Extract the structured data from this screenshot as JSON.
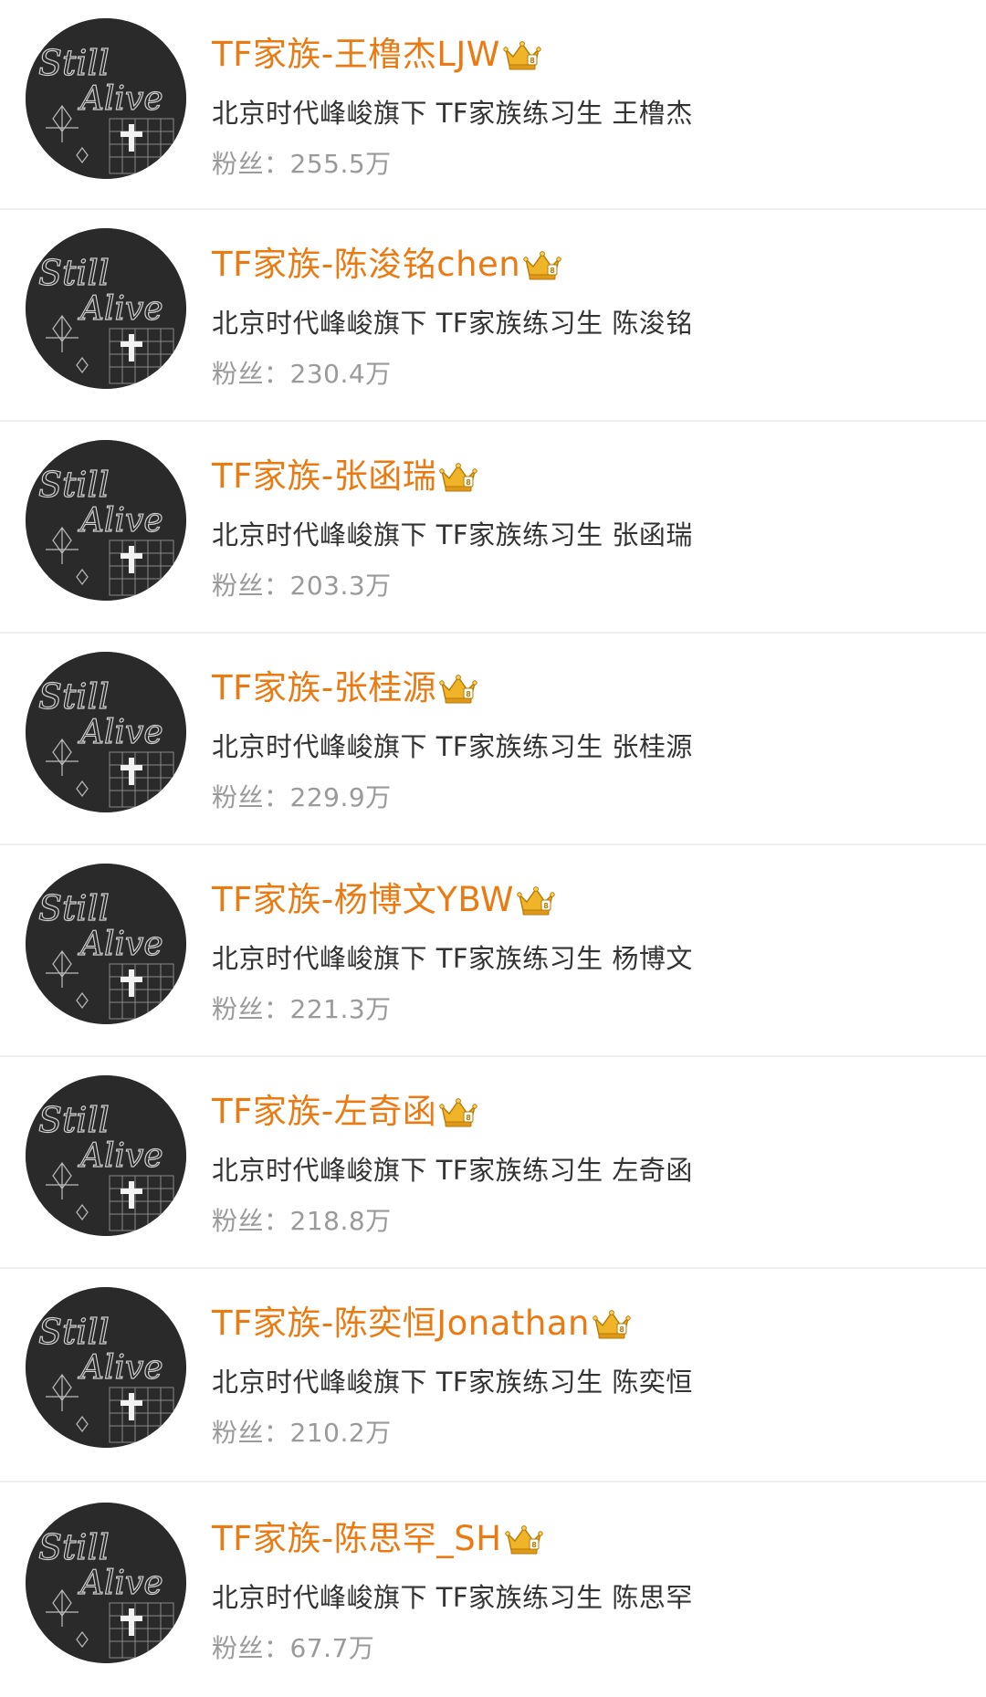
{
  "accounts": [
    {
      "name": "TF家族-王橹杰LJW",
      "desc": "北京时代峰峻旗下 TF家族练习生 王橹杰",
      "fans_label": "粉丝：",
      "fans_value": "255.5万",
      "badge_icon": "crown-icon"
    },
    {
      "name": "TF家族-陈浚铭chen",
      "desc": "北京时代峰峻旗下 TF家族练习生  陈浚铭",
      "fans_label": "粉丝：",
      "fans_value": "230.4万",
      "badge_icon": "crown-icon"
    },
    {
      "name": "TF家族-张函瑞",
      "desc": "北京时代峰峻旗下 TF家族练习生  张函瑞",
      "fans_label": "粉丝：",
      "fans_value": "203.3万",
      "badge_icon": "crown-icon"
    },
    {
      "name": "TF家族-张桂源",
      "desc": "北京时代峰峻旗下 TF家族练习生  张桂源",
      "fans_label": "粉丝：",
      "fans_value": "229.9万",
      "badge_icon": "crown-icon"
    },
    {
      "name": "TF家族-杨博文YBW",
      "desc": "北京时代峰峻旗下 TF家族练习生  杨博文",
      "fans_label": "粉丝：",
      "fans_value": "221.3万",
      "badge_icon": "crown-icon"
    },
    {
      "name": "TF家族-左奇函",
      "desc": "北京时代峰峻旗下 TF家族练习生  左奇函",
      "fans_label": "粉丝：",
      "fans_value": "218.8万",
      "badge_icon": "crown-icon"
    },
    {
      "name": "TF家族-陈奕恒Jonathan",
      "desc": "北京时代峰峻旗下 TF家族练习生 陈奕恒",
      "fans_label": "粉丝：",
      "fans_value": "210.2万",
      "badge_icon": "crown-icon"
    },
    {
      "name": "TF家族-陈思罕_SH",
      "desc": "北京时代峰峻旗下 TF家族练习生 陈思罕",
      "fans_label": "粉丝：",
      "fans_value": "67.7万",
      "badge_icon": "crown-icon"
    }
  ],
  "avatar_text": "Still Alive",
  "colors": {
    "name": "#ea7a11",
    "desc": "#333333",
    "fans": "#9a9a9a",
    "divider": "#efefef",
    "avatar_bg": "#2b2b2b",
    "crown": "#f0b429"
  }
}
